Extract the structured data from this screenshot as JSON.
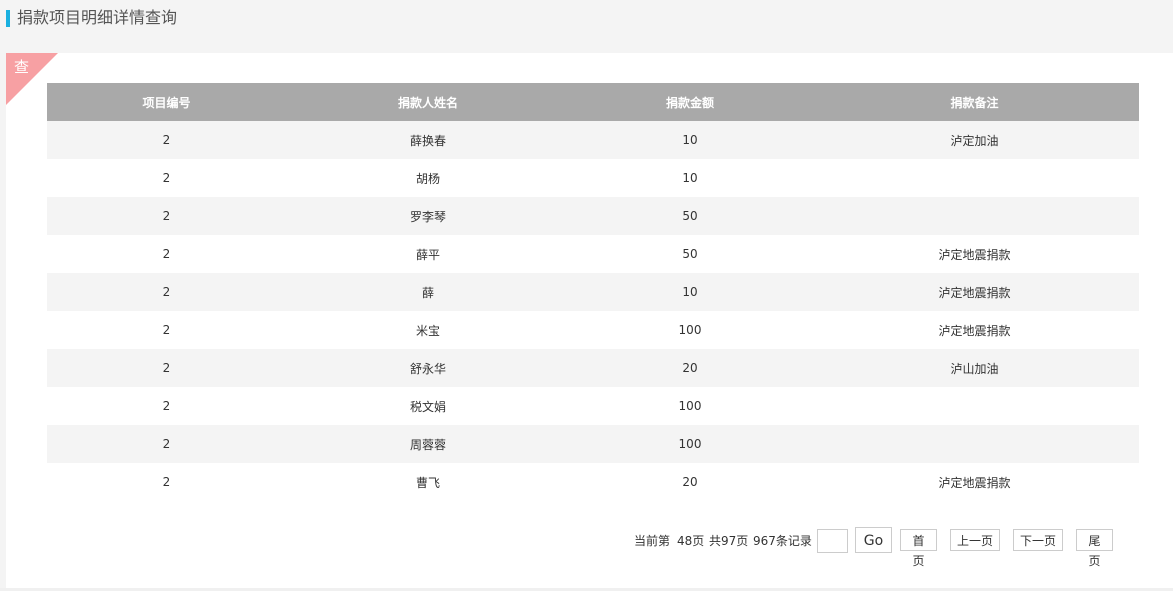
{
  "page": {
    "title": "捐款项目明细详情查询",
    "badge": "查"
  },
  "table": {
    "headers": [
      "项目编号",
      "捐款人姓名",
      "捐款金额",
      "捐款备注"
    ],
    "rows": [
      [
        "2",
        "薛换春",
        "10",
        "泸定加油"
      ],
      [
        "2",
        "胡杨",
        "10",
        ""
      ],
      [
        "2",
        "罗李琴",
        "50",
        ""
      ],
      [
        "2",
        "薛平",
        "50",
        "泸定地震捐款"
      ],
      [
        "2",
        "薛",
        "10",
        "泸定地震捐款"
      ],
      [
        "2",
        "米宝",
        "100",
        "泸定地震捐款"
      ],
      [
        "2",
        "舒永华",
        "20",
        "泸山加油"
      ],
      [
        "2",
        "税文娟",
        "100",
        ""
      ],
      [
        "2",
        "周蓉蓉",
        "100",
        ""
      ],
      [
        "2",
        "曹飞",
        "20",
        "泸定地震捐款"
      ]
    ]
  },
  "pager": {
    "current_prefix": "当前第",
    "current_page": "48页",
    "total_pages": "共97页",
    "total_records": "967条记录",
    "page_input_value": "",
    "go_label": "Go",
    "first_label": "首页",
    "prev_label": "上一页",
    "next_label": "下一页",
    "last_label": "尾页"
  },
  "colors": {
    "accent": "#1ab0e0",
    "header_bg": "#a9a9a9",
    "badge_bg": "#f7a0a3",
    "stripe": "#f4f4f4"
  }
}
